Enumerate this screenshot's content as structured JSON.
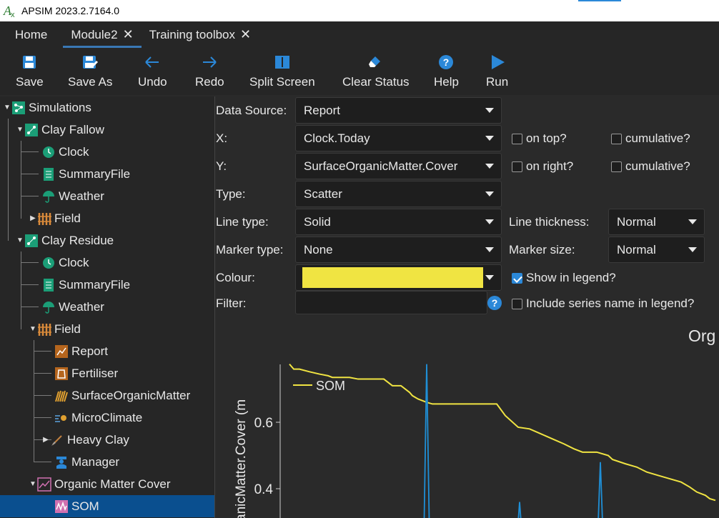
{
  "window": {
    "title": "APSIM 2023.2.7164.0"
  },
  "tabs": [
    {
      "label": "Home",
      "closable": false
    },
    {
      "label": "Module2",
      "closable": true,
      "active": true
    },
    {
      "label": "Training toolbox",
      "closable": true
    }
  ],
  "tab_close_glyph": "✕",
  "toolbar": {
    "save": "Save",
    "save_as": "Save As",
    "undo": "Undo",
    "redo": "Redo",
    "split_screen": "Split Screen",
    "clear_status": "Clear Status",
    "help": "Help",
    "run": "Run"
  },
  "tree": {
    "simulations": "Simulations",
    "clay_fallow": "Clay Fallow",
    "cf_clock": "Clock",
    "cf_summary": "SummaryFile",
    "cf_weather": "Weather",
    "cf_field": "Field",
    "clay_residue": "Clay Residue",
    "cr_clock": "Clock",
    "cr_summary": "SummaryFile",
    "cr_weather": "Weather",
    "cr_field": "Field",
    "report": "Report",
    "fertiliser": "Fertiliser",
    "surface_om": "SurfaceOrganicMatter",
    "microclimate": "MicroClimate",
    "heavy_clay": "Heavy Clay",
    "manager": "Manager",
    "omc": "Organic Matter Cover",
    "som": "SOM"
  },
  "form": {
    "data_source_label": "Data Source:",
    "data_source_value": "Report",
    "x_label": "X:",
    "x_value": "Clock.Today",
    "y_label": "Y:",
    "y_value": "SurfaceOrganicMatter.Cover",
    "type_label": "Type:",
    "type_value": "Scatter",
    "line_type_label": "Line type:",
    "line_type_value": "Solid",
    "marker_type_label": "Marker type:",
    "marker_type_value": "None",
    "colour_label": "Colour:",
    "colour_value": "#f0e442",
    "filter_label": "Filter:",
    "filter_value": "",
    "on_top": "on top?",
    "on_right": "on right?",
    "cumulative_x": "cumulative?",
    "cumulative_y": "cumulative?",
    "line_thickness_label": "Line thickness:",
    "line_thickness_value": "Normal",
    "marker_size_label": "Marker size:",
    "marker_size_value": "Normal",
    "show_in_legend": "Show in legend?",
    "show_in_legend_checked": true,
    "include_series_name": "Include series name in legend?",
    "help_glyph": "?"
  },
  "colors": {
    "accent": "#2b88d8",
    "selected": "#0a4f8f",
    "series_main": "#f0e442",
    "series_secondary": "#1f8fd6"
  },
  "chart_data": {
    "type": "line",
    "title": "Org",
    "ylabel": "anicMatter.Cover (m",
    "yticks": [
      "0.6",
      "0.4"
    ],
    "ylim": [
      0.24,
      0.78
    ],
    "legend": {
      "position": "top-left",
      "entries": [
        "SOM"
      ]
    },
    "series": [
      {
        "name": "SOM",
        "color": "#f0e442",
        "x": [
          0,
          6,
          14,
          28,
          42,
          54,
          60,
          72,
          84,
          96,
          108,
          120,
          132,
          144,
          156,
          168,
          172,
          180,
          192,
          200,
          210,
          222,
          238,
          252,
          264,
          278,
          290,
          302,
          320,
          336,
          352,
          370,
          384,
          398,
          410,
          430,
          446,
          452,
          470,
          486,
          500,
          516,
          532,
          548,
          560,
          570,
          582,
          588,
          596
        ],
        "y": [
          0.775,
          0.76,
          0.76,
          0.752,
          0.745,
          0.74,
          0.735,
          0.735,
          0.735,
          0.73,
          0.73,
          0.73,
          0.73,
          0.71,
          0.71,
          0.69,
          0.68,
          0.67,
          0.66,
          0.655,
          0.655,
          0.655,
          0.655,
          0.655,
          0.655,
          0.655,
          0.655,
          0.62,
          0.585,
          0.58,
          0.565,
          0.548,
          0.535,
          0.52,
          0.51,
          0.51,
          0.5,
          0.488,
          0.475,
          0.465,
          0.45,
          0.44,
          0.43,
          0.42,
          0.405,
          0.39,
          0.38,
          0.37,
          0.365
        ]
      },
      {
        "name": "",
        "color": "#1f8fd6",
        "x": [
          188,
          192,
          196,
          318,
          322,
          326,
          431,
          435,
          439
        ],
        "y": [
          0.24,
          0.775,
          0.24,
          0.24,
          0.36,
          0.24,
          0.24,
          0.48,
          0.24
        ]
      }
    ]
  }
}
